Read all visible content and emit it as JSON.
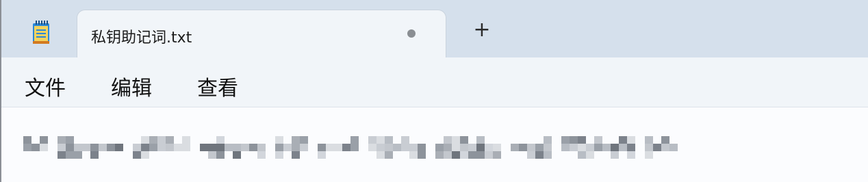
{
  "tab": {
    "title": "私钥助记词.txt",
    "unsaved_indicator": "●",
    "new_tab_symbol": "+"
  },
  "menu": {
    "file": "文件",
    "edit": "编辑",
    "view": "查看"
  },
  "editor": {
    "content_state": "pixelated-redacted-text"
  },
  "colors": {
    "titlebar": "#d5e0ec",
    "tab_bg": "#f1f5f9",
    "accent_icon": "#2b88d8"
  }
}
